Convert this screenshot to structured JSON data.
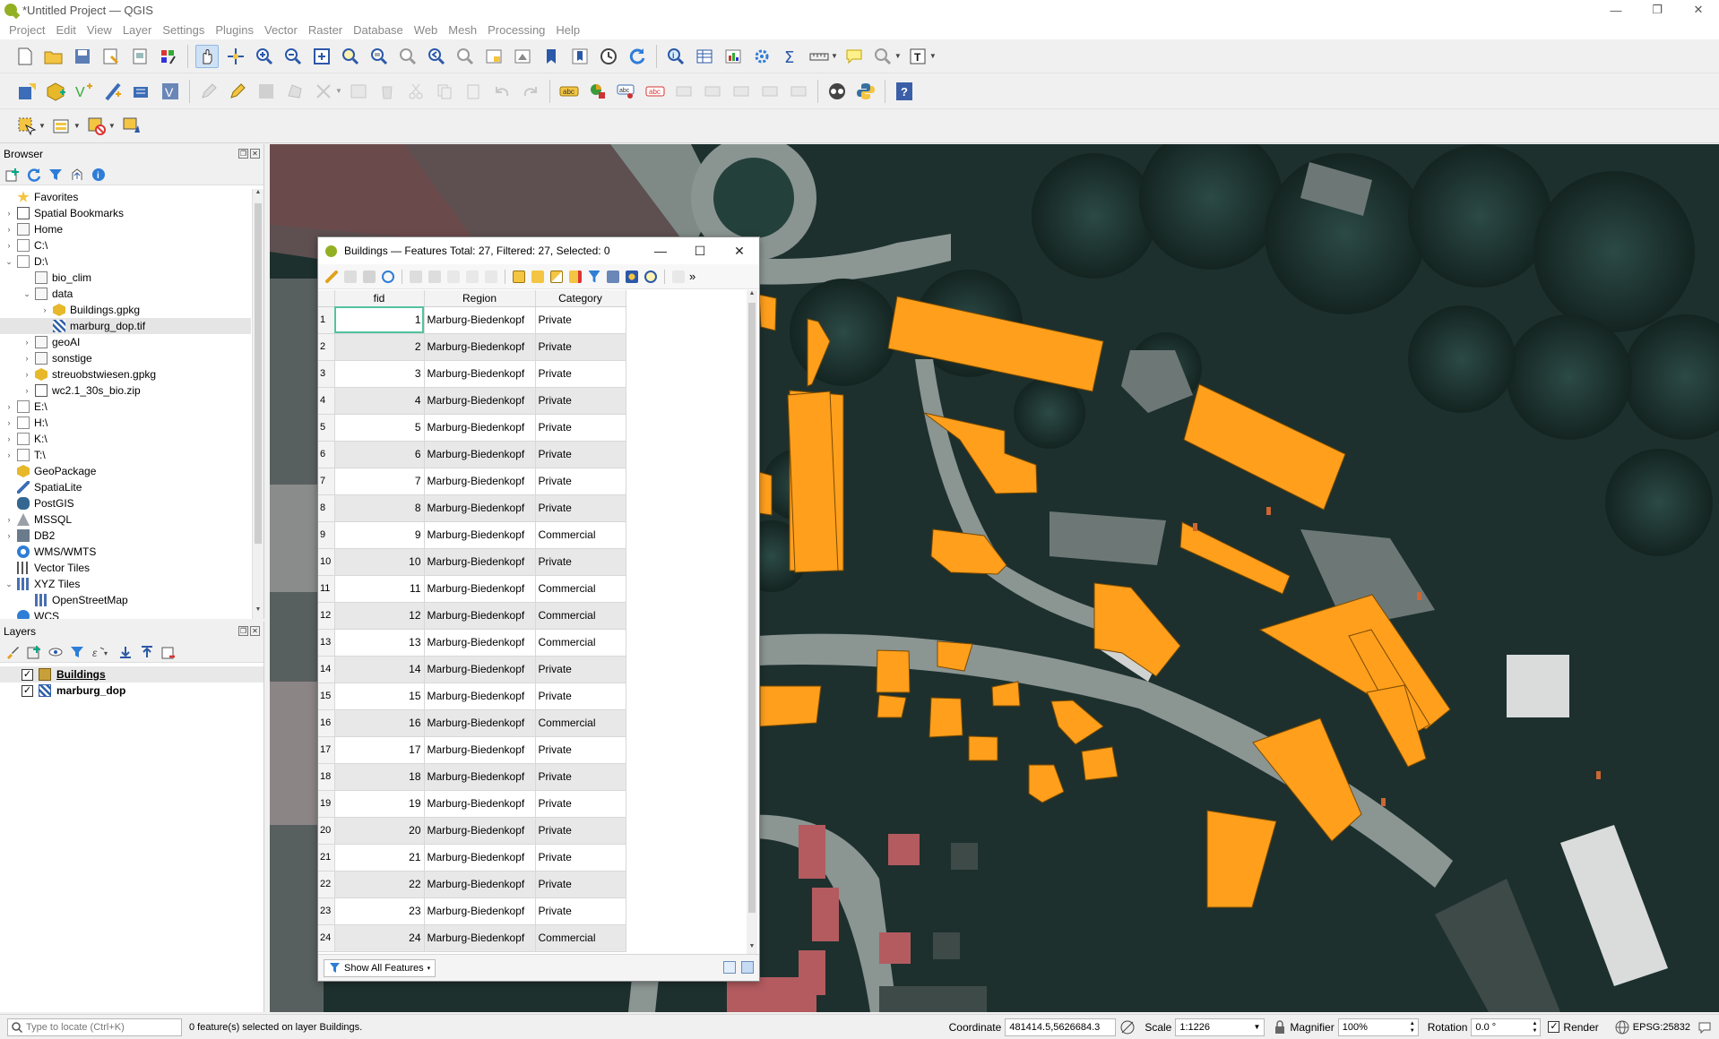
{
  "window": {
    "title": "*Untitled Project — QGIS",
    "controls": [
      "—",
      "❐",
      "✕"
    ]
  },
  "menu": [
    "Project",
    "Edit",
    "View",
    "Layer",
    "Settings",
    "Plugins",
    "Vector",
    "Raster",
    "Database",
    "Web",
    "Mesh",
    "Processing",
    "Help"
  ],
  "browser": {
    "title": "Browser",
    "items": [
      {
        "label": "Favorites",
        "icon": "star-icon",
        "indent": 0,
        "arrow": ""
      },
      {
        "label": "Spatial Bookmarks",
        "icon": "bookmark-icon",
        "indent": 0,
        "arrow": "›"
      },
      {
        "label": "Home",
        "icon": "folder-icon",
        "indent": 0,
        "arrow": "›"
      },
      {
        "label": "C:\\",
        "icon": "drive-icon",
        "indent": 0,
        "arrow": "›"
      },
      {
        "label": "D:\\",
        "icon": "drive-icon",
        "indent": 0,
        "arrow": "⌄"
      },
      {
        "label": "bio_clim",
        "icon": "folder-icon",
        "indent": 1,
        "arrow": ""
      },
      {
        "label": "data",
        "icon": "folder-icon",
        "indent": 1,
        "arrow": "⌄"
      },
      {
        "label": "Buildings.gpkg",
        "icon": "geopackage-icon",
        "indent": 2,
        "arrow": "›"
      },
      {
        "label": "marburg_dop.tif",
        "icon": "raster-icon",
        "indent": 2,
        "arrow": "",
        "selected": true
      },
      {
        "label": "geoAI",
        "icon": "folder-icon",
        "indent": 1,
        "arrow": "›"
      },
      {
        "label": "sonstige",
        "icon": "folder-icon",
        "indent": 1,
        "arrow": "›"
      },
      {
        "label": "streuobstwiesen.gpkg",
        "icon": "geopackage-icon",
        "indent": 1,
        "arrow": "›"
      },
      {
        "label": "wc2.1_30s_bio.zip",
        "icon": "zip-icon",
        "indent": 1,
        "arrow": "›"
      },
      {
        "label": "E:\\",
        "icon": "drive-icon",
        "indent": 0,
        "arrow": "›"
      },
      {
        "label": "H:\\",
        "icon": "drive-icon",
        "indent": 0,
        "arrow": "›"
      },
      {
        "label": "K:\\",
        "icon": "drive-icon",
        "indent": 0,
        "arrow": "›"
      },
      {
        "label": "T:\\",
        "icon": "drive-icon",
        "indent": 0,
        "arrow": "›"
      },
      {
        "label": "GeoPackage",
        "icon": "geopackage-icon",
        "indent": 0,
        "arrow": ""
      },
      {
        "label": "SpatiaLite",
        "icon": "spatialite-icon",
        "indent": 0,
        "arrow": ""
      },
      {
        "label": "PostGIS",
        "icon": "postgis-icon",
        "indent": 0,
        "arrow": ""
      },
      {
        "label": "MSSQL",
        "icon": "mssql-icon",
        "indent": 0,
        "arrow": "›"
      },
      {
        "label": "DB2",
        "icon": "db2-icon",
        "indent": 0,
        "arrow": "›"
      },
      {
        "label": "WMS/WMTS",
        "icon": "wms-icon",
        "indent": 0,
        "arrow": ""
      },
      {
        "label": "Vector Tiles",
        "icon": "vector-tiles-icon",
        "indent": 0,
        "arrow": ""
      },
      {
        "label": "XYZ Tiles",
        "icon": "xyz-tiles-icon",
        "indent": 0,
        "arrow": "⌄"
      },
      {
        "label": "OpenStreetMap",
        "icon": "xyz-tiles-icon",
        "indent": 1,
        "arrow": ""
      },
      {
        "label": "WCS",
        "icon": "wcs-icon",
        "indent": 0,
        "arrow": ""
      }
    ]
  },
  "layers": {
    "title": "Layers",
    "items": [
      {
        "label": "Buildings",
        "checked": "✓",
        "icon_color": "#c8a03a"
      },
      {
        "label": "marburg_dop",
        "checked": "✓",
        "icon_color": "#2e5fa8"
      }
    ]
  },
  "attribute_table": {
    "title": "Buildings — Features Total: 27, Filtered: 27, Selected: 0",
    "columns": [
      "fid",
      "Region",
      "Category"
    ],
    "rows": [
      [
        "1",
        "1",
        "Marburg-Biedenkopf",
        "Private"
      ],
      [
        "2",
        "2",
        "Marburg-Biedenkopf",
        "Private"
      ],
      [
        "3",
        "3",
        "Marburg-Biedenkopf",
        "Private"
      ],
      [
        "4",
        "4",
        "Marburg-Biedenkopf",
        "Private"
      ],
      [
        "5",
        "5",
        "Marburg-Biedenkopf",
        "Private"
      ],
      [
        "6",
        "6",
        "Marburg-Biedenkopf",
        "Private"
      ],
      [
        "7",
        "7",
        "Marburg-Biedenkopf",
        "Private"
      ],
      [
        "8",
        "8",
        "Marburg-Biedenkopf",
        "Private"
      ],
      [
        "9",
        "9",
        "Marburg-Biedenkopf",
        "Commercial"
      ],
      [
        "10",
        "10",
        "Marburg-Biedenkopf",
        "Private"
      ],
      [
        "11",
        "11",
        "Marburg-Biedenkopf",
        "Commercial"
      ],
      [
        "12",
        "12",
        "Marburg-Biedenkopf",
        "Commercial"
      ],
      [
        "13",
        "13",
        "Marburg-Biedenkopf",
        "Commercial"
      ],
      [
        "14",
        "14",
        "Marburg-Biedenkopf",
        "Private"
      ],
      [
        "15",
        "15",
        "Marburg-Biedenkopf",
        "Private"
      ],
      [
        "16",
        "16",
        "Marburg-Biedenkopf",
        "Commercial"
      ],
      [
        "17",
        "17",
        "Marburg-Biedenkopf",
        "Private"
      ],
      [
        "18",
        "18",
        "Marburg-Biedenkopf",
        "Private"
      ],
      [
        "19",
        "19",
        "Marburg-Biedenkopf",
        "Private"
      ],
      [
        "20",
        "20",
        "Marburg-Biedenkopf",
        "Private"
      ],
      [
        "21",
        "21",
        "Marburg-Biedenkopf",
        "Private"
      ],
      [
        "22",
        "22",
        "Marburg-Biedenkopf",
        "Private"
      ],
      [
        "23",
        "23",
        "Marburg-Biedenkopf",
        "Private"
      ],
      [
        "24",
        "24",
        "Marburg-Biedenkopf",
        "Commercial"
      ]
    ],
    "show_all_label": "Show All Features",
    "more_tools": "»"
  },
  "status": {
    "locator_placeholder": "Type to locate (Ctrl+K)",
    "message": "0 feature(s) selected on layer Buildings.",
    "coordinate_label": "Coordinate",
    "coordinate_value": "481414.5,5626684.3",
    "scale_label": "Scale",
    "scale_value": "1:1226",
    "magnifier_label": "Magnifier",
    "magnifier_value": "100%",
    "rotation_label": "Rotation",
    "rotation_value": "0.0 °",
    "render_label": "Render",
    "crs": "EPSG:25832"
  },
  "colors": {
    "building_fill": "#ff9f1c",
    "map_dark": "#1f3533",
    "qgis_green": "#93b023"
  }
}
